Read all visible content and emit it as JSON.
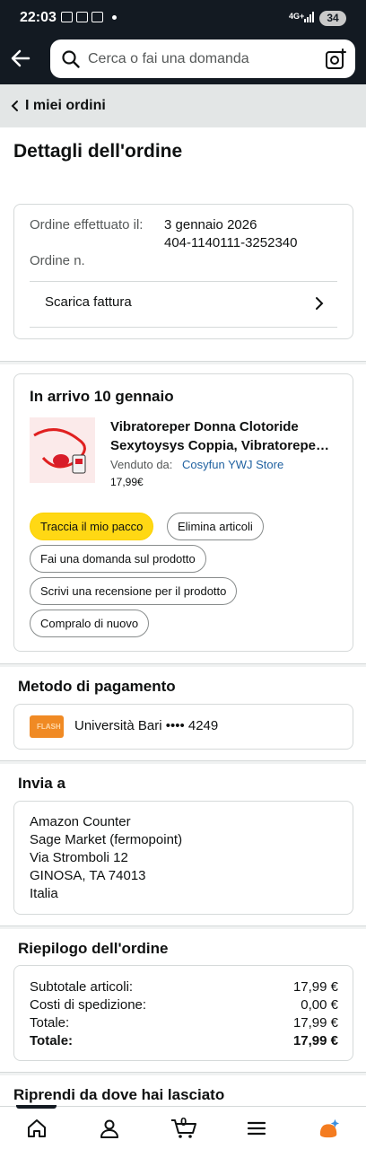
{
  "status": {
    "time": "22:03",
    "network": "4G+",
    "battery": "34"
  },
  "search": {
    "placeholder": "Cerca o fai una domanda"
  },
  "breadcrumb": {
    "label": "I miei ordini"
  },
  "page": {
    "title": "Dettagli dell'ordine"
  },
  "order_info": {
    "placed_label": "Ordine effettuato il:",
    "placed_value": "3 gennaio 2026",
    "number_label": "Ordine n.",
    "number_value": "404-1140111-3252340",
    "invoice_label": "Scarica fattura"
  },
  "shipment": {
    "title": "In arrivo 10 gennaio",
    "product_title": "Vibratoreper Donna Clotoride Sexytoysys Coppia, Vibratorepe…",
    "sold_by_label": "Venduto da:",
    "seller": "Cosyfun YWJ Store",
    "price": "17,99€",
    "buttons": {
      "track": "Traccia il mio pacco",
      "delete": "Elimina articoli",
      "ask": "Fai una domanda sul prodotto",
      "review": "Scrivi una recensione per il prodotto",
      "buy_again": "Compralo di nuovo"
    }
  },
  "payment": {
    "title": "Metodo di pagamento",
    "card_text": "Università Bari •••• 4249",
    "card_logo_text": "FLASH"
  },
  "shipping": {
    "title": "Invia a",
    "lines": [
      "Amazon Counter",
      "Sage Market (fermopoint)",
      "Via Stromboli 12",
      "GINOSA, TA 74013",
      "Italia"
    ]
  },
  "summary": {
    "title": "Riepilogo dell'ordine",
    "rows": [
      {
        "label": "Subtotale articoli:",
        "value": "17,99 €"
      },
      {
        "label": "Costi di spedizione:",
        "value": "0,00 €"
      },
      {
        "label": "Totale:",
        "value": "17,99 €"
      },
      {
        "label": "Totale:",
        "value": "17,99 €"
      }
    ]
  },
  "resume": {
    "title": "Riprendi da dove hai lasciato"
  },
  "nav": {
    "cart_count": "0"
  },
  "colors": {
    "header": "#131a22",
    "accent_button": "#ffd814",
    "link": "#2162a1",
    "card_logo": "#f08a24"
  }
}
